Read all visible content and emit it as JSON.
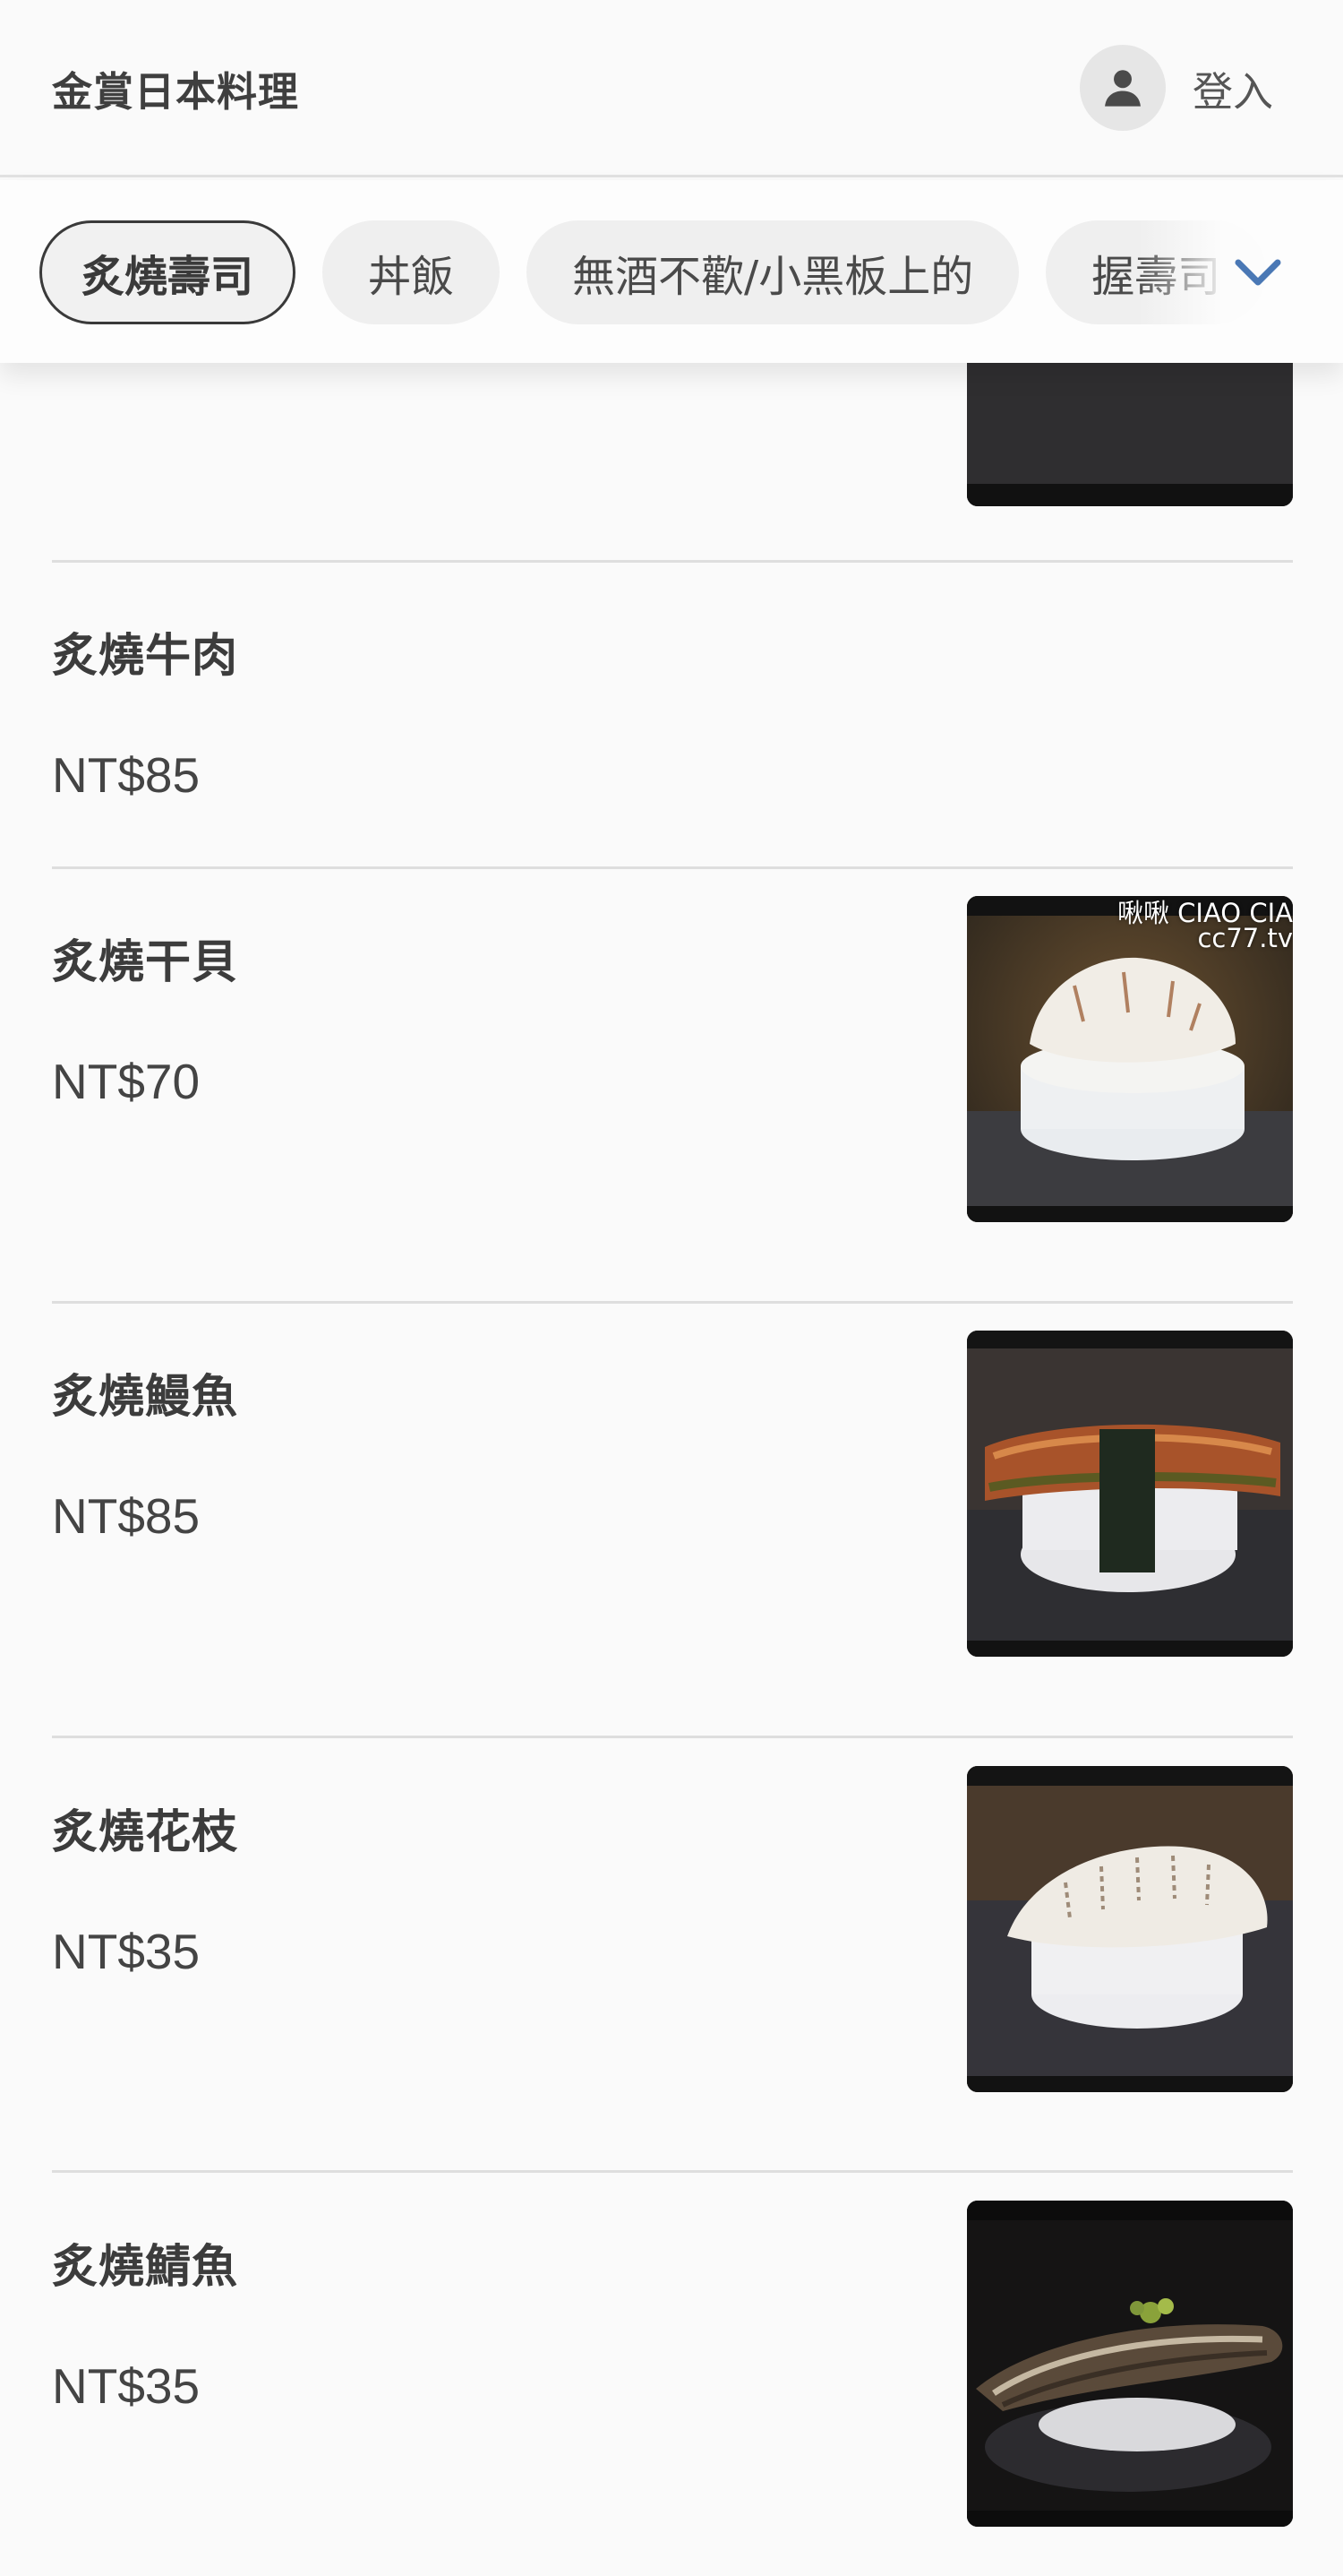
{
  "header": {
    "store_name": "金賞日本料理",
    "login_label": "登入"
  },
  "tabs": [
    {
      "label": "炙燒壽司",
      "active": true
    },
    {
      "label": "丼飯"
    },
    {
      "label": "無酒不歡/小黑板上的"
    },
    {
      "label": "握壽司"
    }
  ],
  "icons": {
    "avatar": "person-icon",
    "more": "chevron-down-icon"
  },
  "menu_items": [
    {
      "name": "炙燒牛肉",
      "price": "NT$85"
    },
    {
      "name": "炙燒干貝",
      "price": "NT$70"
    },
    {
      "name": "炙燒鰻魚",
      "price": "NT$85"
    },
    {
      "name": "炙燒花枝",
      "price": "NT$35"
    },
    {
      "name": "炙燒鯖魚",
      "price": "NT$35"
    }
  ],
  "watermark": {
    "line1": "啾啾 CIAO CIA",
    "line2": "cc77.tv"
  },
  "colors": {
    "accent": "#4a78b5",
    "background": "#fafafa",
    "divider": "#dedede"
  }
}
